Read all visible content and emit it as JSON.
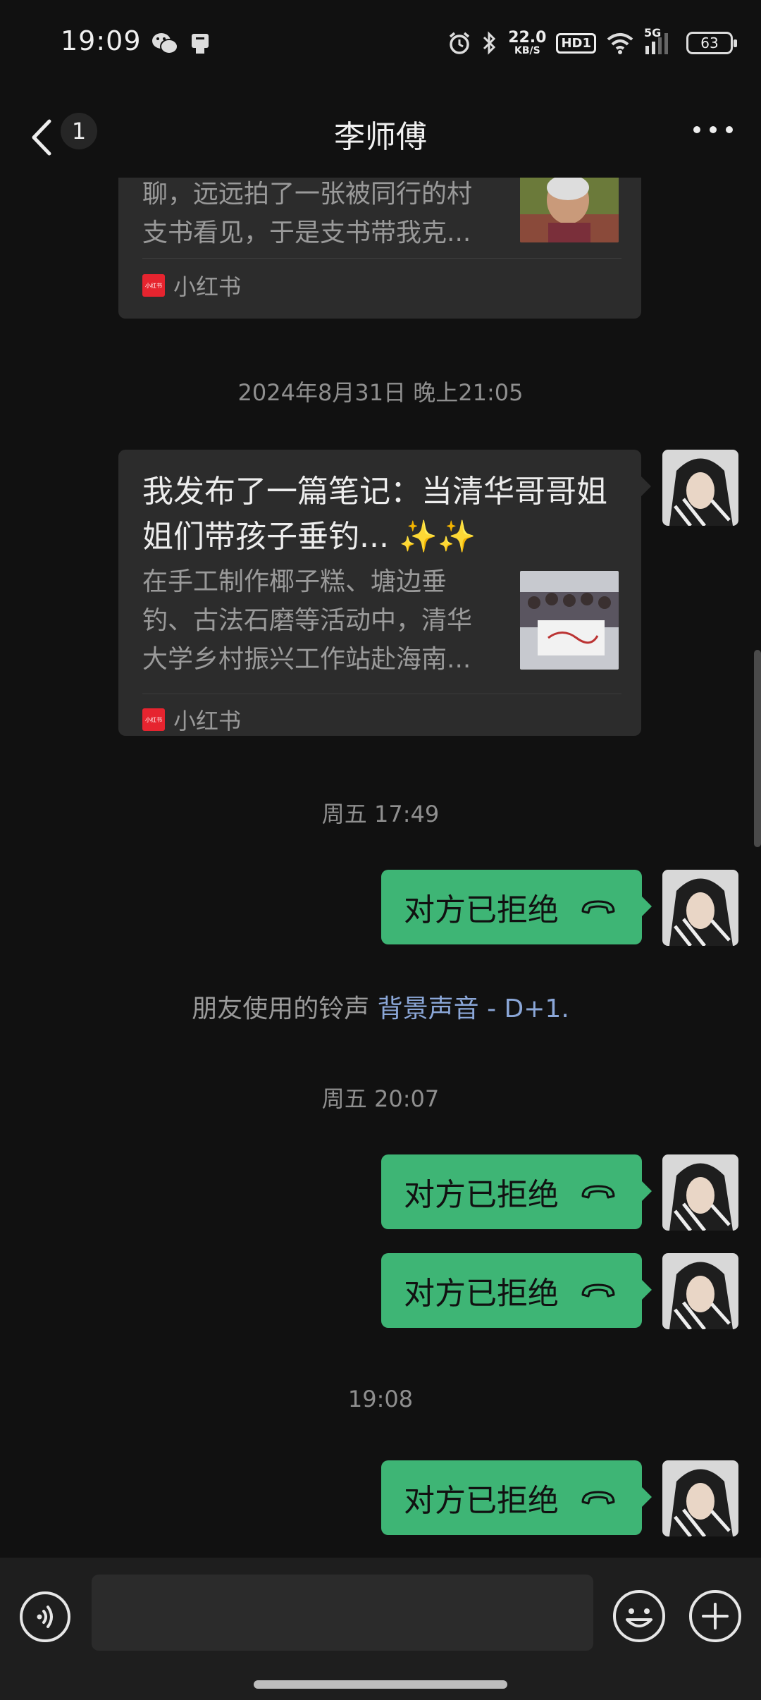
{
  "status_bar": {
    "time": "19:09",
    "net_speed_value": "22.0",
    "net_speed_unit": "KB/S",
    "hd_label": "HD1",
    "network_label": "5G",
    "battery_level": "63"
  },
  "header": {
    "title": "李师傅",
    "unread_count": "1"
  },
  "messages": {
    "card1": {
      "desc_line1": "聊，远远拍了一张被同行的村",
      "desc_line2": "支书看见，于是支书带我克...",
      "source": "小红书"
    },
    "ts1": "2024年8月31日 晚上21:05",
    "card2": {
      "title_line1": "我发布了一篇笔记：当清华哥哥姐",
      "title_line2": "姐们带孩子垂钓... ✨✨",
      "desc_line1": "在手工制作椰子糕、塘边垂",
      "desc_line2": "钓、古法石磨等活动中，清华",
      "desc_line3": "大学乡村振兴工作站赴海南...",
      "source": "小红书"
    },
    "ts2": "周五 17:49",
    "call1": "对方已拒绝",
    "ringtone_prefix": "朋友使用的铃声",
    "ringtone_link": "背景声音 - D+1.",
    "ts3": "周五 20:07",
    "call2": "对方已拒绝",
    "call3": "对方已拒绝",
    "ts4": "19:08",
    "call4": "对方已拒绝"
  },
  "input": {
    "value": ""
  },
  "colors": {
    "background": "#111111",
    "bubble_green": "#3eb575",
    "card_bg": "#2c2c2c",
    "link_blue": "#8ba7d8",
    "xhs_red": "#e6242f"
  }
}
